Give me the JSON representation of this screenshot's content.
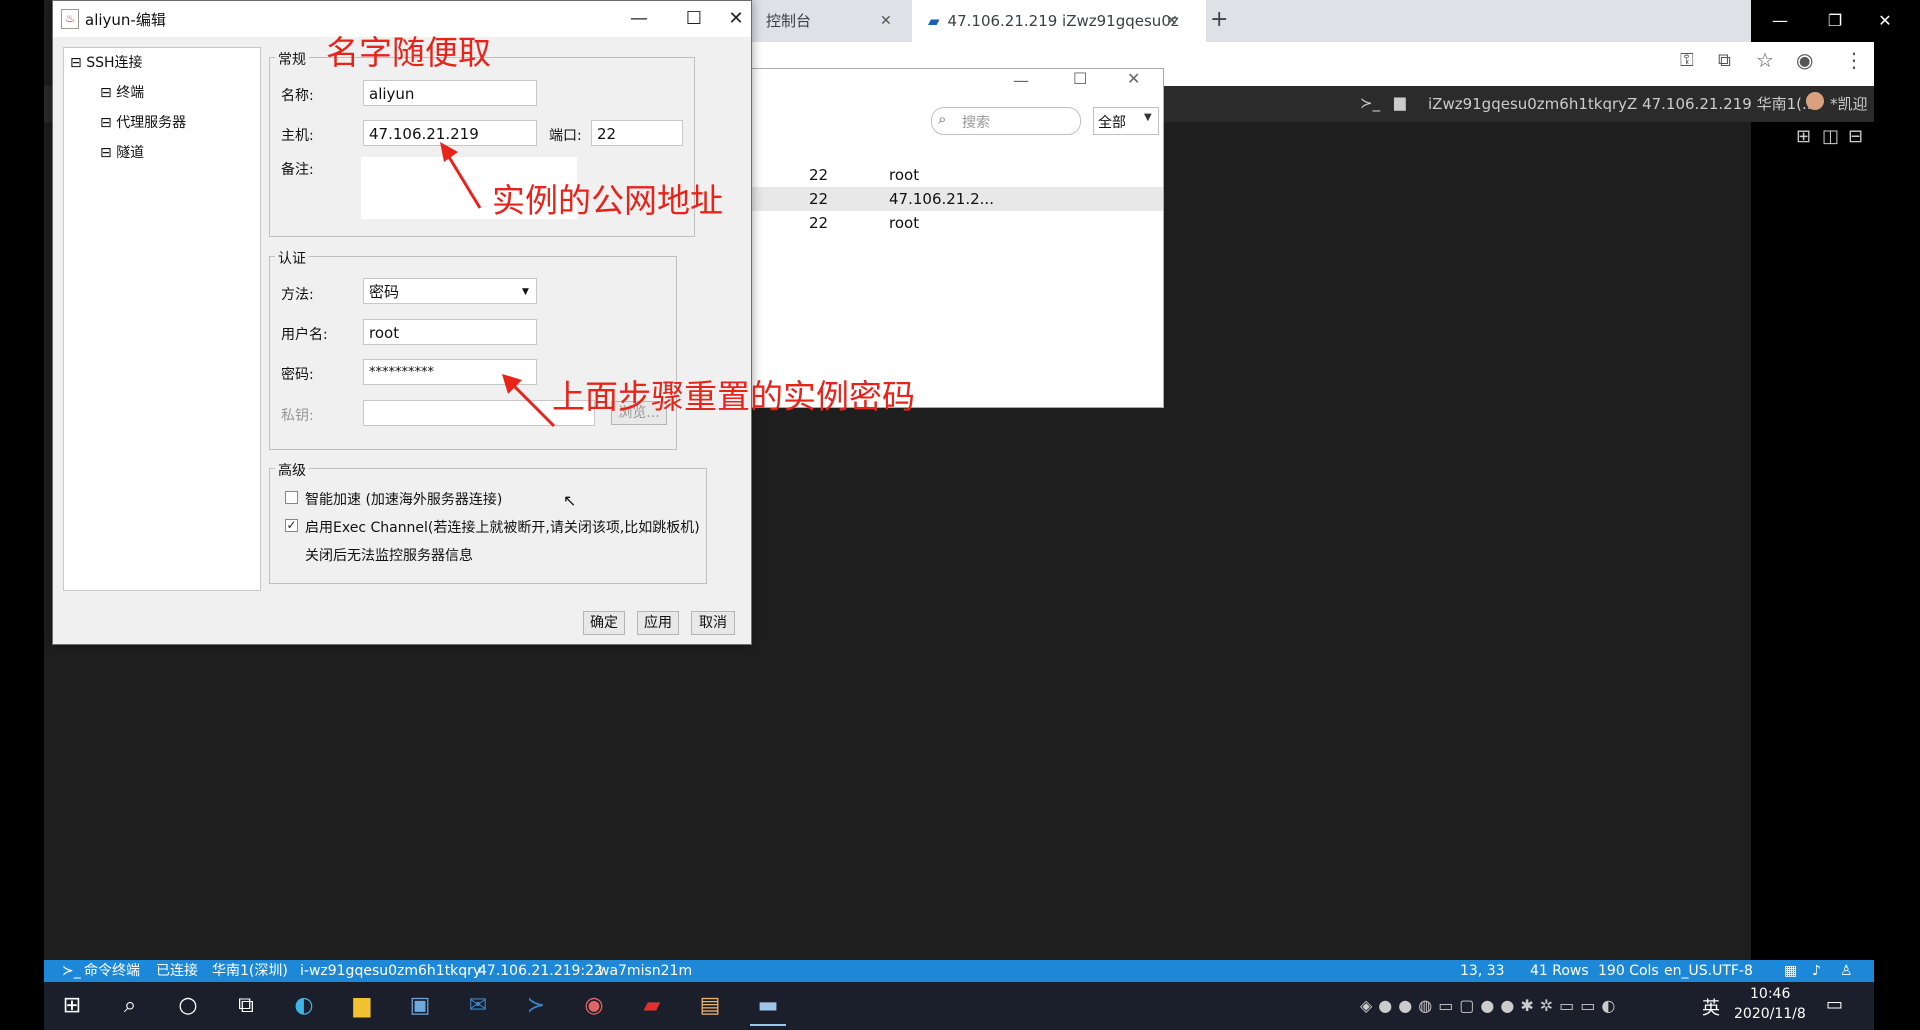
{
  "browser": {
    "tab1_label": "控制台",
    "tab2_label": "47.106.21.219 iZwz91gqesu0z",
    "new_tab": "+",
    "win_min": "—",
    "win_restore": "❐",
    "win_close": "✕"
  },
  "app": {
    "header_path": "iZwz91gqesu0zm6h1tkqryZ 47.106.21.219 华南1(...",
    "header_user": "*凯迎"
  },
  "session_window": {
    "search_placeholder": "搜索",
    "filter_value": "全部",
    "rows": [
      {
        "port": "22",
        "user": "root"
      },
      {
        "port": "22",
        "user": "47.106.21.2..."
      },
      {
        "port": "22",
        "user": "root"
      }
    ]
  },
  "dialog": {
    "title": "aliyun-编辑",
    "tree": {
      "root": "SSH连接",
      "items": [
        "终端",
        "代理服务器",
        "隧道"
      ]
    },
    "general": {
      "legend": "常规",
      "name_label": "名称:",
      "name_value": "aliyun",
      "host_label": "主机:",
      "host_value": "47.106.21.219",
      "port_label": "端口:",
      "port_value": "22",
      "note_label": "备注:"
    },
    "auth": {
      "legend": "认证",
      "method_label": "方法:",
      "method_value": "密码",
      "user_label": "用户名:",
      "user_value": "root",
      "password_label": "密码:",
      "password_value": "**********",
      "key_label": "私钥:",
      "browse_label": "浏览..."
    },
    "advanced": {
      "legend": "高级",
      "smart_accel": "智能加速 (加速海外服务器连接)",
      "exec_channel": "启用Exec Channel(若连接上就被断开,请关闭该项,比如跳板机)",
      "exec_note": "关闭后无法监控服务器信息"
    },
    "buttons": {
      "ok": "确定",
      "apply": "应用",
      "cancel": "取消"
    }
  },
  "annotations": {
    "name_hint": "名字随便取",
    "host_hint": "实例的公网地址",
    "password_hint": "上面步骤重置的实例密码"
  },
  "statusbar": {
    "terminal": "命令终端",
    "connected": "已连接",
    "region": "华南1(深圳)",
    "instance": "i-wz91gqesu0zm6h1tkqry",
    "address": "47.106.21.219:22",
    "session": "wa7misn21m",
    "cursor": "13, 33",
    "rows": "41 Rows",
    "cols": "190 Cols",
    "encoding": "en_US.UTF-8"
  },
  "taskbar": {
    "ime": "英",
    "time": "10:46",
    "date": "2020/11/8"
  }
}
